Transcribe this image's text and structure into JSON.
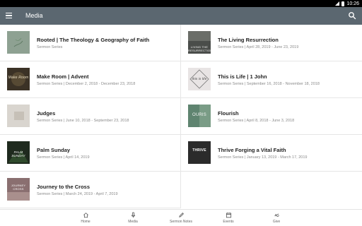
{
  "status_bar": {
    "time": "10:26"
  },
  "app_bar": {
    "title": "Media"
  },
  "items": [
    {
      "title": "Rooted | The Theology & Geography of Faith",
      "subtitle": "Sermon Series",
      "thumb_text": "",
      "thumb_color": "#8ea192"
    },
    {
      "title": "The Living Resurrection",
      "subtitle": "Sermon Series | April 28, 2019 - June 23, 2019",
      "thumb_text": "LIVING THE RESURRECTION",
      "thumb_color": "#4a4d4a"
    },
    {
      "title": "Make Room | Advent",
      "subtitle": "Sermon Series | December 2, 2018 - December 23, 2018",
      "thumb_text": "Make Room",
      "thumb_color": "#3b3226"
    },
    {
      "title": "This is Life | 1 John",
      "subtitle": "Sermon Series | September 16, 2018 - November 18, 2018",
      "thumb_text": "this is life",
      "thumb_color": "#e8e4e4"
    },
    {
      "title": "Judges",
      "subtitle": "Sermon Series | June 10, 2018 - September 23, 2018",
      "thumb_text": "",
      "thumb_color": "#d9d5cf"
    },
    {
      "title": "Flourish",
      "subtitle": "Sermon Series | April 8, 2018 - June 3, 2018",
      "thumb_text": "OURIS",
      "thumb_color": "#7a9c86"
    },
    {
      "title": "Palm Sunday",
      "subtitle": "Sermon Series | April 14, 2019",
      "thumb_text": "PALM SUNDAY",
      "thumb_color": "#1f2a1e"
    },
    {
      "title": "Thrive Forging a Vital Faith",
      "subtitle": "Sermon Series | January 13, 2019 - March 17, 2019",
      "thumb_text": "THRIVE",
      "thumb_color": "#2b2b2b"
    },
    {
      "title": "Journey to the Cross",
      "subtitle": "Sermon Series | March 24, 2019 - April 7, 2019",
      "thumb_text": "JOURNEY CROSS",
      "thumb_color": "#8a6f70"
    }
  ],
  "nav": [
    {
      "label": "Home",
      "icon": "home-icon"
    },
    {
      "label": "Media",
      "icon": "microphone-icon"
    },
    {
      "label": "Sermon Notes",
      "icon": "pencil-icon"
    },
    {
      "label": "Events",
      "icon": "calendar-icon"
    },
    {
      "label": "Give",
      "icon": "give-icon"
    }
  ],
  "colors": {
    "app_bar": "#5b6770",
    "status_bar": "#000000"
  }
}
